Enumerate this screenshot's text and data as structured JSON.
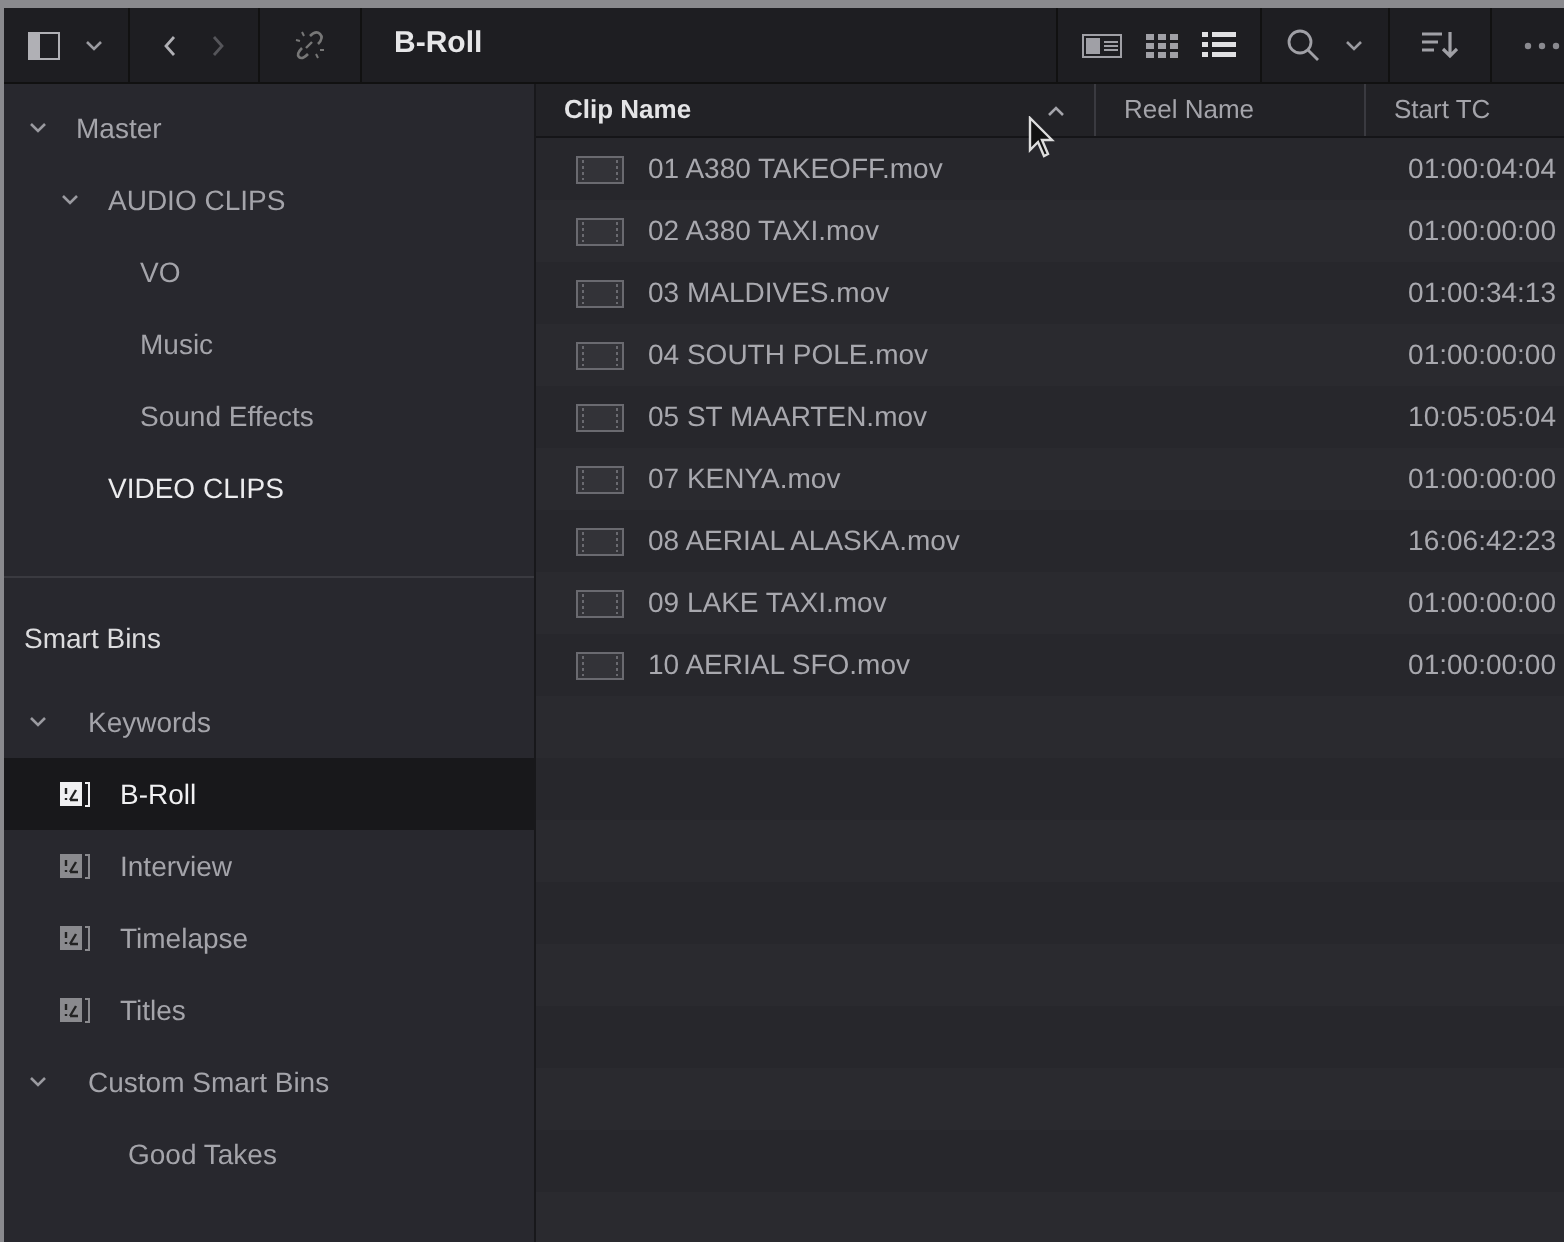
{
  "toolbar": {
    "title": "B-Roll",
    "view_modes": [
      {
        "kind": "metadata",
        "selected": false
      },
      {
        "kind": "thumbnail",
        "selected": false
      },
      {
        "kind": "list",
        "selected": true
      }
    ]
  },
  "bin_tree": [
    {
      "label": "Master",
      "expanded": true,
      "emphasized": false,
      "children": [
        {
          "label": "AUDIO CLIPS",
          "expanded": true,
          "emphasized": false,
          "children": [
            {
              "label": "VO",
              "emphasized": false
            },
            {
              "label": "Music",
              "emphasized": false
            },
            {
              "label": "Sound Effects",
              "emphasized": false
            }
          ]
        },
        {
          "label": "VIDEO CLIPS",
          "emphasized": true
        }
      ]
    }
  ],
  "smart_bins": {
    "title": "Smart Bins",
    "groups": [
      {
        "label": "Keywords",
        "expanded": true,
        "items": [
          {
            "label": "B-Roll",
            "kind": "keyword",
            "selected": true
          },
          {
            "label": "Interview",
            "kind": "keyword",
            "selected": false
          },
          {
            "label": "Timelapse",
            "kind": "keyword",
            "selected": false
          },
          {
            "label": "Titles",
            "kind": "keyword",
            "selected": false
          }
        ]
      },
      {
        "label": "Custom Smart Bins",
        "expanded": true,
        "items": [
          {
            "label": "Good Takes",
            "kind": "custom",
            "selected": false
          }
        ]
      }
    ]
  },
  "table": {
    "columns": [
      {
        "label": "Clip Name",
        "sorted": true
      },
      {
        "label": "Reel Name",
        "sorted": false
      },
      {
        "label": "Start TC",
        "sorted": false
      }
    ],
    "rows": [
      {
        "clip_name": "01 A380 TAKEOFF.mov",
        "start_tc": "01:00:04:04"
      },
      {
        "clip_name": "02 A380 TAXI.mov",
        "start_tc": "01:00:00:00"
      },
      {
        "clip_name": "03 MALDIVES.mov",
        "start_tc": "01:00:34:13"
      },
      {
        "clip_name": "04 SOUTH POLE.mov",
        "start_tc": "01:00:00:00"
      },
      {
        "clip_name": "05 ST MAARTEN.mov",
        "start_tc": "10:05:05:04"
      },
      {
        "clip_name": "07 KENYA.mov",
        "start_tc": "01:00:00:00"
      },
      {
        "clip_name": "08 AERIAL ALASKA.mov",
        "start_tc": "16:06:42:23"
      },
      {
        "clip_name": "09 LAKE TAXI.mov",
        "start_tc": "01:00:00:00"
      },
      {
        "clip_name": "10 AERIAL SFO.mov",
        "start_tc": "01:00:00:00"
      }
    ]
  }
}
